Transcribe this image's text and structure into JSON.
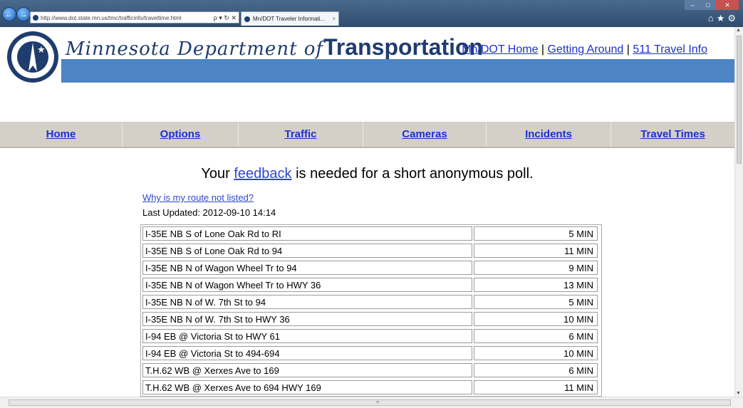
{
  "browser": {
    "url": "http://www.dot.state.mn.us/tmc/trafficinfo/traveltime.html",
    "address_controls": "ρ ▾ ↻ ✕",
    "tab_title": "Mn/DOT Traveler Informati...",
    "tab_close": "×"
  },
  "header": {
    "brand_script": "Minnesota Department of",
    "brand_bold": "Transportation",
    "links": [
      "Mn/DOT Home",
      "Getting Around",
      "511 Travel Info"
    ],
    "separator": "|"
  },
  "nav": {
    "items": [
      "Home",
      "Options",
      "Traffic",
      "Cameras",
      "Incidents",
      "Travel Times"
    ]
  },
  "poll": {
    "prefix": "Your",
    "link": "feedback",
    "suffix": "is needed for a short anonymous poll."
  },
  "why_link": "Why is my route not listed?",
  "last_updated": "Last Updated: 2012-09-10 14:14",
  "routes": [
    {
      "name": "I-35E NB S of Lone Oak Rd to RI",
      "time": "5 MIN"
    },
    {
      "name": "I-35E NB S of Lone Oak Rd to 94",
      "time": "11 MIN"
    },
    {
      "name": "I-35E NB N of Wagon Wheel Tr to 94",
      "time": "9 MIN"
    },
    {
      "name": "I-35E NB N of Wagon Wheel Tr to HWY 36",
      "time": "13 MIN"
    },
    {
      "name": "I-35E NB N of W. 7th St to 94",
      "time": "5 MIN"
    },
    {
      "name": "I-35E NB N of W. 7th St to HWY 36",
      "time": "10 MIN"
    },
    {
      "name": "I-94 EB @ Victoria St to HWY 61",
      "time": "6 MIN"
    },
    {
      "name": "I-94 EB @ Victoria St to 494-694",
      "time": "10 MIN"
    },
    {
      "name": "T.H.62 WB @ Xerxes Ave to 169",
      "time": "6 MIN"
    },
    {
      "name": "T.H.62 WB @ Xerxes Ave to 694 HWY 169",
      "time": "11 MIN"
    }
  ]
}
